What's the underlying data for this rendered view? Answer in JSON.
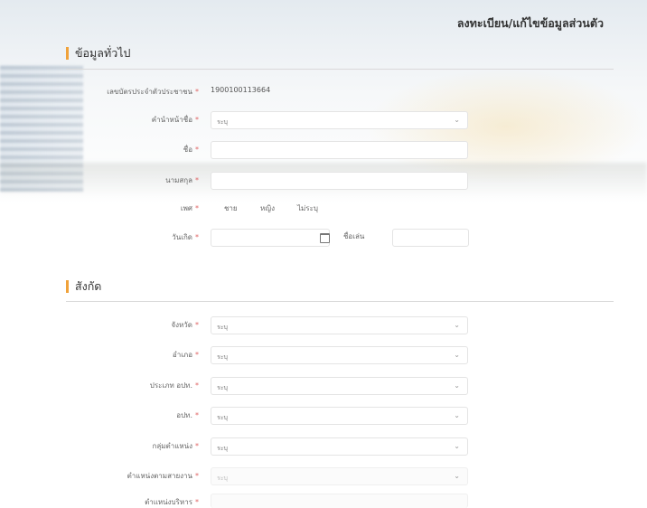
{
  "page_title": "ลงทะเบียน/แก้ไขข้อมูลส่วนตัว",
  "required_mark": "*",
  "accent_color": "#f0a23a",
  "general": {
    "heading": "ข้อมูลทั่วไป",
    "id_card_label": "เลขบัตรประจำตัวประชาชน",
    "id_card_value": "1900100113664",
    "prefix_label": "คำนำหน้าชื่อ",
    "prefix_value": "ระบุ",
    "first_name_label": "ชื่อ",
    "first_name_value": "",
    "last_name_label": "นามสกุล",
    "last_name_value": "",
    "gender_label": "เพศ",
    "gender_options": [
      "ชาย",
      "หญิง",
      "ไม่ระบุ"
    ],
    "birthdate_label": "วันเกิด",
    "birthdate_value": "",
    "nickname_label": "ชื่อเล่น",
    "nickname_value": ""
  },
  "affiliation": {
    "heading": "สังกัด",
    "fields": [
      {
        "label": "จังหวัด",
        "value": "ระบุ"
      },
      {
        "label": "อำเภอ",
        "value": "ระบุ"
      },
      {
        "label": "ประเภท อปท.",
        "value": "ระบุ"
      },
      {
        "label": "อปท.",
        "value": "ระบุ"
      },
      {
        "label": "กลุ่มตำแหน่ง",
        "value": "ระบุ"
      },
      {
        "label": "ตำแหน่งตามสายงาน",
        "value": "ระบุ"
      },
      {
        "label": "ตำแหน่งบริหาร",
        "value": ""
      }
    ]
  }
}
